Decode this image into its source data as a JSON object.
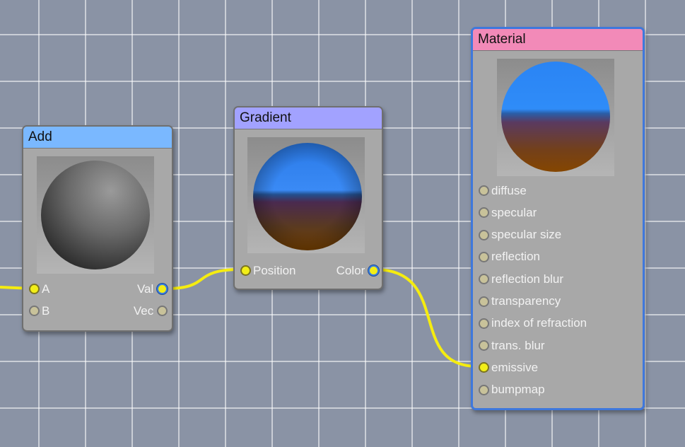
{
  "colors": {
    "wire": "#f5ec10",
    "add_header": "#7ab8ff",
    "gradient_header": "#a2a2ff",
    "material_header": "#f28ab8",
    "selected_border": "#3f78dc"
  },
  "nodes": {
    "add": {
      "title": "Add",
      "inputs": [
        "A",
        "B"
      ],
      "outputs": [
        "Val",
        "Vec"
      ]
    },
    "gradient": {
      "title": "Gradient",
      "inputs": [
        "Position"
      ],
      "outputs": [
        "Color"
      ]
    },
    "material": {
      "title": "Material",
      "inputs": [
        "diffuse",
        "specular",
        "specular size",
        "reflection",
        "reflection blur",
        "transparency",
        "index of refraction",
        "trans. blur",
        "emissive",
        "bumpmap"
      ]
    }
  }
}
